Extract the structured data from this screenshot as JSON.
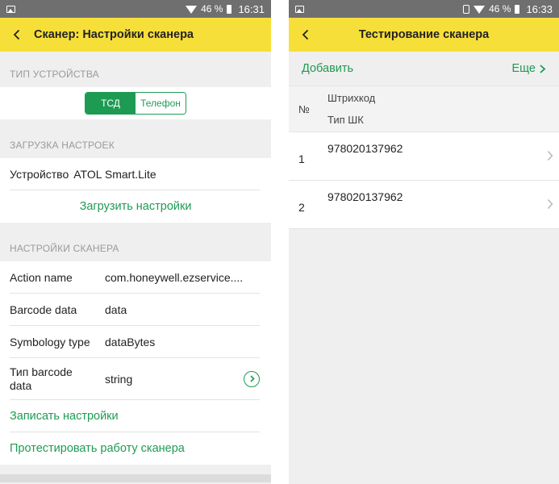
{
  "left": {
    "status": {
      "battery": "46 %",
      "time": "16:31"
    },
    "appbar": {
      "title": "Сканер: Настройки сканера"
    },
    "device_type": {
      "header": "ТИП УСТРОЙСТВА",
      "options": [
        "ТСД",
        "Телефон"
      ],
      "selected": "ТСД"
    },
    "load_settings": {
      "header": "ЗАГРУЗКА НАСТРОЕК",
      "device_label": "Устройство",
      "device_value": "ATOL Smart.Lite",
      "load_button": "Загрузить настройки"
    },
    "scanner_settings": {
      "header": "НАСТРОЙКИ СКАНЕРА",
      "rows": [
        {
          "label": "Action name",
          "value": "com.honeywell.ezservice...."
        },
        {
          "label": "Barcode data",
          "value": "data"
        },
        {
          "label": "Symbology type",
          "value": "dataBytes"
        },
        {
          "label": "Тип barcode data",
          "value": "string"
        }
      ],
      "save_button": "Записать настройки",
      "test_button": "Протестировать работу сканера"
    }
  },
  "right": {
    "status": {
      "battery": "46 %",
      "time": "16:33"
    },
    "appbar": {
      "title": "Тестирование сканера"
    },
    "commands": {
      "add": "Добавить",
      "more": "Еще"
    },
    "table": {
      "col_num": "№",
      "col_barcode": "Штрихкод",
      "col_type": "Тип ШК",
      "rows": [
        {
          "num": "1",
          "barcode": "978020137962"
        },
        {
          "num": "2",
          "barcode": "978020137962"
        }
      ]
    }
  },
  "colors": {
    "appbar": "#f7df3a",
    "accent": "#1e9b53",
    "statusbar": "#6f6f6f"
  },
  "icons": [
    "image-icon",
    "wifi-icon",
    "battery-icon",
    "vibrate-icon",
    "back-arrow-icon",
    "chevron-right-icon",
    "circle-arrow-icon"
  ]
}
